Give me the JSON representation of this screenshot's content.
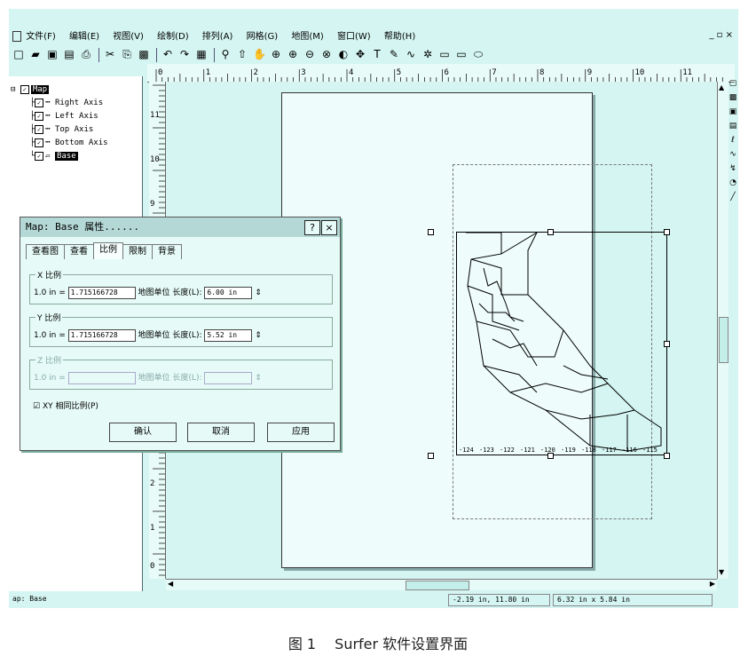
{
  "menu": {
    "items": [
      "文件(F)",
      "编辑(E)",
      "视图(V)",
      "绘制(D)",
      "排列(A)",
      "网格(G)",
      "地图(M)",
      "窗口(W)",
      "帮助(H)"
    ],
    "window_controls": "_ ▫ ×"
  },
  "toolbar": {
    "icons": [
      "□",
      "▰",
      "▣",
      "▤",
      "⎙",
      "✂",
      "⎘",
      "▩",
      "↶",
      "↷",
      "▦",
      "⚲",
      "⇧",
      "✋",
      "⊕",
      "⊕",
      "⊖",
      "⊗",
      "◐",
      "✥",
      "T",
      "✎",
      "∿",
      "✲",
      "▭",
      "▭",
      "⬭"
    ]
  },
  "tree": {
    "root": "Map",
    "items": [
      "Right Axis",
      "Left Axis",
      "Top Axis",
      "Bottom Axis",
      "Base"
    ]
  },
  "ruler": {
    "h_labels": [
      "0",
      "1",
      "2",
      "3",
      "4",
      "5",
      "6",
      "7",
      "8",
      "9",
      "10",
      "11"
    ],
    "v_labels": [
      "11",
      "10",
      "9",
      "2",
      "1",
      "0"
    ]
  },
  "map": {
    "axis_labels": [
      "-124",
      "-123",
      "-122",
      "-121",
      "-120",
      "-119",
      "-118",
      "-117",
      "-116",
      "-115"
    ]
  },
  "dialog": {
    "title": "Map: Base 属性......",
    "help_btn": "?",
    "close_btn": "×",
    "tabs": [
      "查看图",
      "查看",
      "比例",
      "限制",
      "背景"
    ],
    "active_tab": 2,
    "x_group": {
      "legend": "X 比例",
      "prefix": "1.0 in =",
      "value": "1.715166728",
      "unit_label": "地图单位",
      "length_label": "长度(L):",
      "length_value": "6.00 in"
    },
    "y_group": {
      "legend": "Y 比例",
      "prefix": "1.0 in =",
      "value": "1.715166728",
      "unit_label": "地图单位",
      "length_label": "长度(L):",
      "length_value": "5.52 in"
    },
    "z_group": {
      "legend": "Z 比例",
      "prefix": "1.0 in =",
      "value": "",
      "unit_label": "地图单位",
      "length_label": "长度(L):",
      "length_value": ""
    },
    "proportional": {
      "label": "XY 相同比例(P)",
      "checked": true
    },
    "buttons": {
      "ok": "确认",
      "cancel": "取消",
      "apply": "应用"
    }
  },
  "status": {
    "left": "ap: Base",
    "coords": "-2.19 in, 11.80 in",
    "size": "6.32 in x 5.84 in"
  },
  "caption": "图 1　 Surfer 软件设置界面",
  "colors": {
    "background": "#d4f5f1",
    "title": "#b4d8d6"
  }
}
